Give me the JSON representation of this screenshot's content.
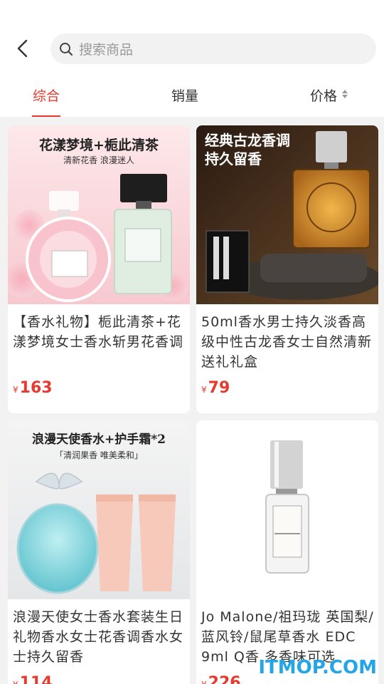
{
  "search": {
    "placeholder": "搜索商品"
  },
  "tabs": [
    {
      "label": "综合"
    },
    {
      "label": "销量"
    },
    {
      "label": "价格"
    }
  ],
  "products": [
    {
      "banner_line1": "花漾梦境+栀此清茶",
      "banner_line2": "清新花香 浪漫迷人",
      "title": "【香水礼物】栀此清茶+花漾梦境女士香水斩男花香调",
      "currency": "¥",
      "price": "163"
    },
    {
      "banner_line1": "经典古龙香调",
      "banner_line2": "持久留香",
      "title": "50ml香水男士持久淡香高级中性古龙香女士自然清新送礼礼盒",
      "currency": "¥",
      "price": "79"
    },
    {
      "banner_line1": "浪漫天使香水+护手霜*2",
      "banner_line2": "「清润果香 唯美柔和」",
      "title": "浪漫天使女士香水套装生日礼物香水女士花香调香水女士持久留香",
      "currency": "¥",
      "price": "114"
    },
    {
      "title": "Jo Malone/祖玛珑 英国梨/蓝风铃/鼠尾草香水 EDC 9ml Q香 多香味可选",
      "currency": "¥",
      "price": "226"
    }
  ],
  "watermark": "ITMOP.COM",
  "colors": {
    "accent": "#e8392e"
  }
}
